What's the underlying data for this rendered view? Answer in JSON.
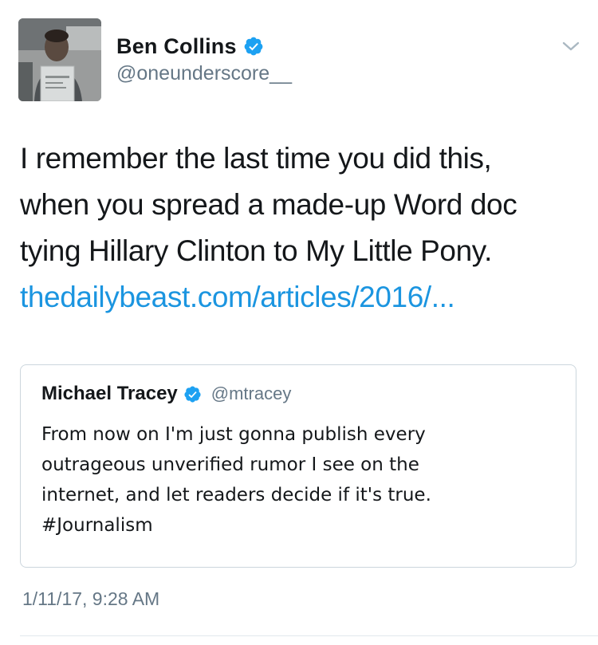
{
  "author": {
    "name": "Ben Collins",
    "handle": "@oneunderscore__",
    "verified": true
  },
  "tweet": {
    "lines": [
      "I remember the last time you did this,",
      "when you spread a made-up Word doc",
      "tying Hillary Clinton to My Little Pony."
    ],
    "link": "thedailybeast.com/articles/2016/..."
  },
  "quoted_tweet": {
    "name": "Michael Tracey",
    "handle": "@mtracey",
    "verified": true,
    "lines": [
      "From now on I'm just gonna publish every",
      "outrageous unverified rumor I see on the",
      "internet, and let readers decide if it's true.",
      "#Journalism"
    ]
  },
  "timestamp": "1/11/17, 9:28 AM",
  "colors": {
    "link": "#1b95e0",
    "verified_badge": "#1da1f2",
    "secondary_text": "#657786",
    "border": "#ccd6dd"
  },
  "icons": {
    "verified": "verified-badge-icon",
    "menu": "chevron-down-icon"
  }
}
